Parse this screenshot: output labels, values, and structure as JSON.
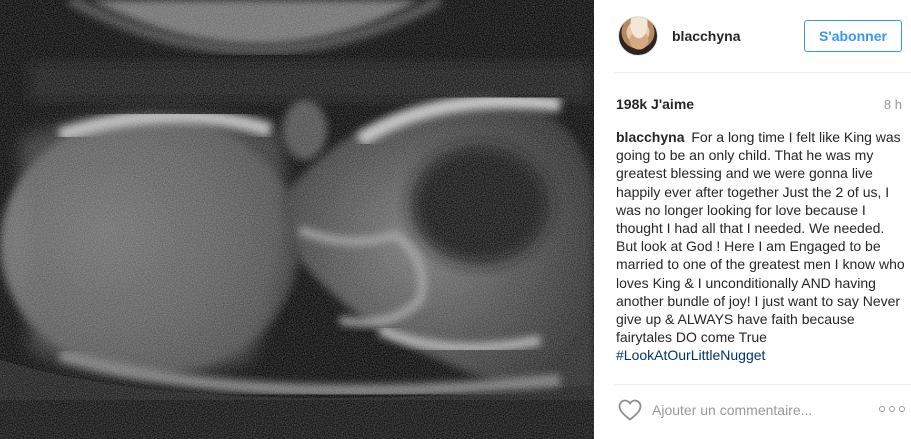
{
  "photo": {
    "alt_icon": "ultrasound-image"
  },
  "header": {
    "username": "blacchyna",
    "follow_label": "S'abonner"
  },
  "meta": {
    "likes": "198k J'aime",
    "time": "8 h"
  },
  "caption": {
    "username": "blacchyna",
    "text": "For a long time I felt like King was going to be an only child. That he was my greatest blessing and we were gonna live happily ever after together Just the 2 of us, I was no longer looking for love because I thought I had all that I needed. We needed. But look at God ! Here I am Engaged to be married to one of the greatest men I know who loves King & I unconditionally AND having another bundle of joy! I just want to say Never give up & ALWAYS have faith because fairytales DO come True",
    "hashtag": "#LookAtOurLittleNugget"
  },
  "comment": {
    "placeholder": "Ajouter un commentaire..."
  },
  "colors": {
    "accent": "#3897f0",
    "text": "#262626",
    "muted": "#999999",
    "hashtag": "#003569"
  }
}
